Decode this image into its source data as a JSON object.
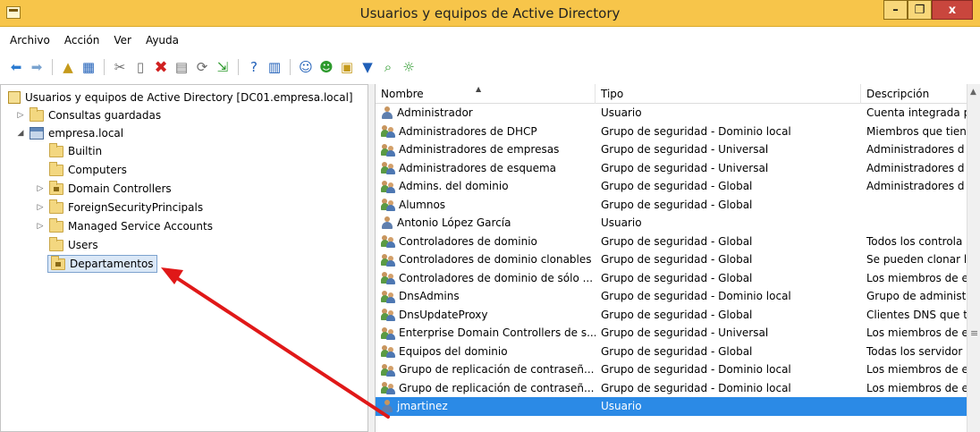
{
  "window": {
    "title": "Usuarios y equipos de Active Directory",
    "minimize_label": "–",
    "maximize_label": "❐",
    "close_label": "x"
  },
  "menu": [
    "Archivo",
    "Acción",
    "Ver",
    "Ayuda"
  ],
  "toolbar_icons": [
    "back-arrow-icon",
    "forward-arrow-icon",
    "up-folder-icon",
    "show-console-tree-icon",
    "cut-icon",
    "copy-icon",
    "delete-icon",
    "properties-icon",
    "refresh-icon",
    "export-icon",
    "help-icon",
    "view-icon",
    "new-user-icon",
    "new-group-icon",
    "new-ou-icon",
    "filter-icon",
    "find-icon",
    "add-to-group-icon"
  ],
  "tree": {
    "root": "Usuarios y equipos de Active Directory [DC01.empresa.local]",
    "saved_queries": "Consultas guardadas",
    "domain": "empresa.local",
    "children": [
      "Builtin",
      "Computers",
      "Domain Controllers",
      "ForeignSecurityPrincipals",
      "Managed Service Accounts",
      "Users",
      "Departamentos"
    ]
  },
  "list": {
    "columns": [
      "Nombre",
      "Tipo",
      "Descripción"
    ],
    "rows": [
      {
        "name": "Administrador",
        "type": "Usuario",
        "desc": "Cuenta integrada p",
        "kind": "user"
      },
      {
        "name": "Administradores de DHCP",
        "type": "Grupo de seguridad - Dominio local",
        "desc": "Miembros que tien",
        "kind": "group"
      },
      {
        "name": "Administradores de empresas",
        "type": "Grupo de seguridad - Universal",
        "desc": "Administradores d",
        "kind": "group"
      },
      {
        "name": "Administradores de esquema",
        "type": "Grupo de seguridad - Universal",
        "desc": "Administradores d",
        "kind": "group"
      },
      {
        "name": "Admins. del dominio",
        "type": "Grupo de seguridad - Global",
        "desc": "Administradores d",
        "kind": "group"
      },
      {
        "name": "Alumnos",
        "type": "Grupo de seguridad - Global",
        "desc": "",
        "kind": "group"
      },
      {
        "name": "Antonio López García",
        "type": "Usuario",
        "desc": "",
        "kind": "user"
      },
      {
        "name": "Controladores de dominio",
        "type": "Grupo de seguridad - Global",
        "desc": "Todos los controla",
        "kind": "group"
      },
      {
        "name": "Controladores de dominio clonables",
        "type": "Grupo de seguridad - Global",
        "desc": "Se pueden clonar l",
        "kind": "group"
      },
      {
        "name": "Controladores de dominio de sólo ...",
        "type": "Grupo de seguridad - Global",
        "desc": "Los miembros de e",
        "kind": "group"
      },
      {
        "name": "DnsAdmins",
        "type": "Grupo de seguridad - Dominio local",
        "desc": "Grupo de administ",
        "kind": "group"
      },
      {
        "name": "DnsUpdateProxy",
        "type": "Grupo de seguridad - Global",
        "desc": "Clientes DNS que t",
        "kind": "group"
      },
      {
        "name": "Enterprise Domain Controllers de s...",
        "type": "Grupo de seguridad - Universal",
        "desc": "Los miembros de e",
        "kind": "group"
      },
      {
        "name": "Equipos del dominio",
        "type": "Grupo de seguridad - Global",
        "desc": "Todas los servidor",
        "kind": "group"
      },
      {
        "name": "Grupo de replicación de contraseñ...",
        "type": "Grupo de seguridad - Dominio local",
        "desc": "Los miembros de e",
        "kind": "group"
      },
      {
        "name": "Grupo de replicación de contraseñ...",
        "type": "Grupo de seguridad - Dominio local",
        "desc": "Los miembros de e",
        "kind": "group"
      },
      {
        "name": "jmartinez",
        "type": "Usuario",
        "desc": "",
        "kind": "user"
      }
    ],
    "selected_index": 16
  },
  "colors": {
    "titlebar": "#f7c54a",
    "selection": "#2b8ae6",
    "annotation_arrow": "#e01818"
  }
}
